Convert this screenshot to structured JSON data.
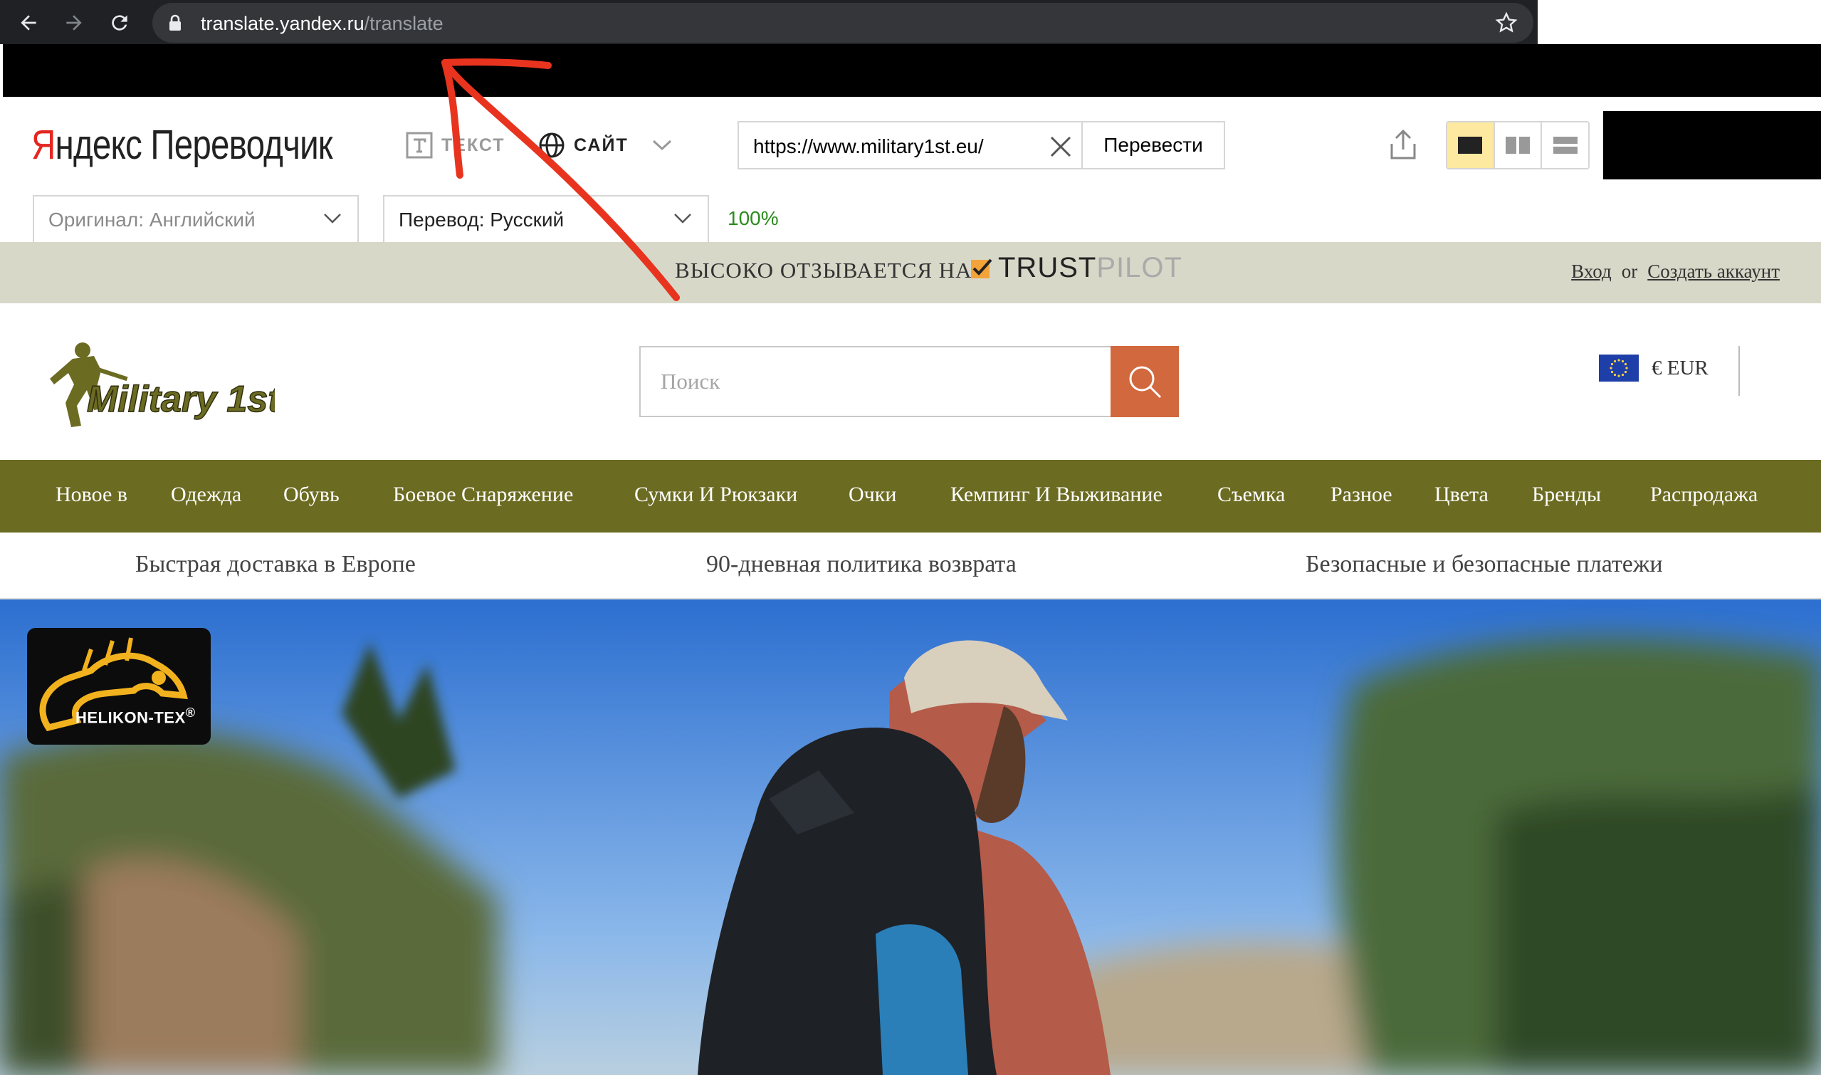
{
  "browser": {
    "url_host": "translate.yandex.ru",
    "url_path": "/translate"
  },
  "translator": {
    "logo_ya": "Я",
    "logo_rest": "ндекс",
    "logo_product": "Переводчик",
    "mode_text_label": "ТЕКСТ",
    "mode_site_label": "САЙТ",
    "url_value": "https://www.military1st.eu/",
    "translate_button": "Перевести",
    "source_lang": "Оригинал: Английский",
    "target_lang": "Перевод: Русский",
    "progress": "100%"
  },
  "site": {
    "trust_text": "ВЫСОКО ОТЗЫВАЕТСЯ НА",
    "trustpilot_a": "TRUST",
    "trustpilot_b": "PILOT",
    "login": "Вход",
    "or": "or",
    "create_account": "Создать аккаунт",
    "logo_text": "Military 1st",
    "search_placeholder": "Поиск",
    "currency": "€ EUR",
    "nav": [
      "Новое в",
      "Одежда",
      "Обувь",
      "Боевое Снаряжение",
      "Сумки И Рюкзаки",
      "Очки",
      "Кемпинг И Выживание",
      "Съемка",
      "Разное",
      "Цвета",
      "Бренды",
      "Распродажа"
    ],
    "benefits": [
      "Быстрая доставка в Европе",
      "90-дневная политика возврата",
      "Безопасные и безопасные платежи"
    ],
    "brand_badge": "HELIKON-TEX",
    "brand_badge_mark": "®"
  },
  "colors": {
    "nav_bg": "#6b6b22",
    "trust_bg": "#d7d8c8",
    "search_btn": "#d2683d",
    "annotation": "#e8341f"
  }
}
